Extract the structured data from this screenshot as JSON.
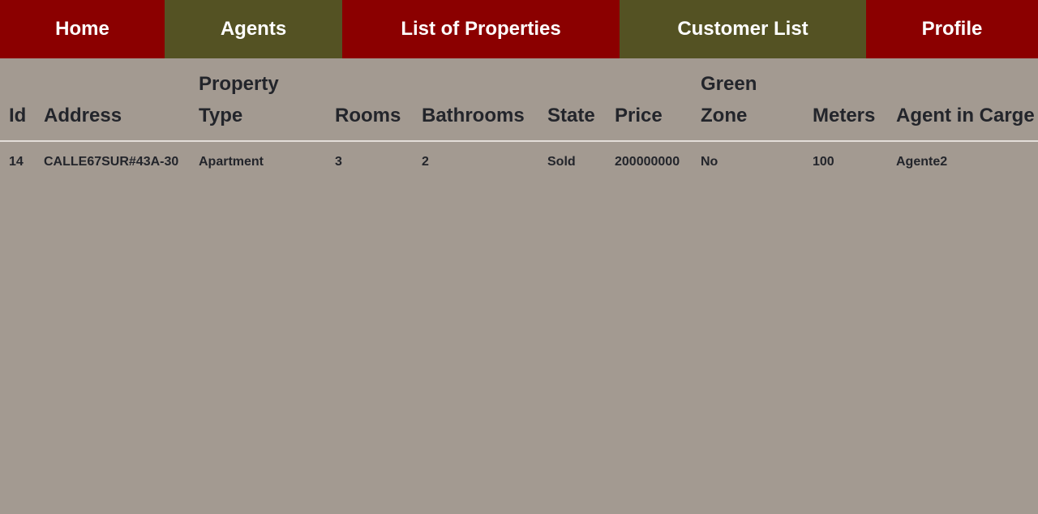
{
  "nav": {
    "items": [
      {
        "label": "Home"
      },
      {
        "label": "Agents"
      },
      {
        "label": "List of Properties"
      },
      {
        "label": "Customer List"
      },
      {
        "label": "Profile"
      }
    ]
  },
  "table": {
    "headers": [
      "Id",
      "Address",
      "Property Type",
      "Rooms",
      "Bathrooms",
      "State",
      "Price",
      "Green Zone",
      "Meters",
      "Agent in Carge"
    ],
    "rows": [
      [
        "14",
        "CALLE67SUR#43A-30",
        "Apartment",
        "3",
        "2",
        "Sold",
        "200000000",
        "No",
        "100",
        "Agente2"
      ]
    ]
  },
  "colors": {
    "nav_red": "#8b0000",
    "nav_olive": "#545223",
    "background": "#a39a91"
  }
}
